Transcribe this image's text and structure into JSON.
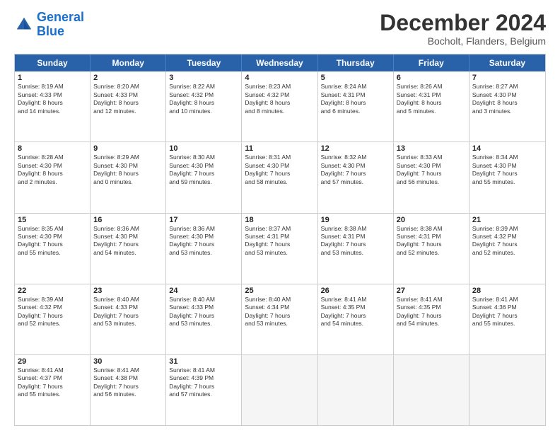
{
  "header": {
    "logo_line1": "General",
    "logo_line2": "Blue",
    "month": "December 2024",
    "location": "Bocholt, Flanders, Belgium"
  },
  "days": [
    "Sunday",
    "Monday",
    "Tuesday",
    "Wednesday",
    "Thursday",
    "Friday",
    "Saturday"
  ],
  "rows": [
    [
      {
        "day": "1",
        "lines": [
          "Sunrise: 8:19 AM",
          "Sunset: 4:33 PM",
          "Daylight: 8 hours",
          "and 14 minutes."
        ]
      },
      {
        "day": "2",
        "lines": [
          "Sunrise: 8:20 AM",
          "Sunset: 4:33 PM",
          "Daylight: 8 hours",
          "and 12 minutes."
        ]
      },
      {
        "day": "3",
        "lines": [
          "Sunrise: 8:22 AM",
          "Sunset: 4:32 PM",
          "Daylight: 8 hours",
          "and 10 minutes."
        ]
      },
      {
        "day": "4",
        "lines": [
          "Sunrise: 8:23 AM",
          "Sunset: 4:32 PM",
          "Daylight: 8 hours",
          "and 8 minutes."
        ]
      },
      {
        "day": "5",
        "lines": [
          "Sunrise: 8:24 AM",
          "Sunset: 4:31 PM",
          "Daylight: 8 hours",
          "and 6 minutes."
        ]
      },
      {
        "day": "6",
        "lines": [
          "Sunrise: 8:26 AM",
          "Sunset: 4:31 PM",
          "Daylight: 8 hours",
          "and 5 minutes."
        ]
      },
      {
        "day": "7",
        "lines": [
          "Sunrise: 8:27 AM",
          "Sunset: 4:30 PM",
          "Daylight: 8 hours",
          "and 3 minutes."
        ]
      }
    ],
    [
      {
        "day": "8",
        "lines": [
          "Sunrise: 8:28 AM",
          "Sunset: 4:30 PM",
          "Daylight: 8 hours",
          "and 2 minutes."
        ]
      },
      {
        "day": "9",
        "lines": [
          "Sunrise: 8:29 AM",
          "Sunset: 4:30 PM",
          "Daylight: 8 hours",
          "and 0 minutes."
        ]
      },
      {
        "day": "10",
        "lines": [
          "Sunrise: 8:30 AM",
          "Sunset: 4:30 PM",
          "Daylight: 7 hours",
          "and 59 minutes."
        ]
      },
      {
        "day": "11",
        "lines": [
          "Sunrise: 8:31 AM",
          "Sunset: 4:30 PM",
          "Daylight: 7 hours",
          "and 58 minutes."
        ]
      },
      {
        "day": "12",
        "lines": [
          "Sunrise: 8:32 AM",
          "Sunset: 4:30 PM",
          "Daylight: 7 hours",
          "and 57 minutes."
        ]
      },
      {
        "day": "13",
        "lines": [
          "Sunrise: 8:33 AM",
          "Sunset: 4:30 PM",
          "Daylight: 7 hours",
          "and 56 minutes."
        ]
      },
      {
        "day": "14",
        "lines": [
          "Sunrise: 8:34 AM",
          "Sunset: 4:30 PM",
          "Daylight: 7 hours",
          "and 55 minutes."
        ]
      }
    ],
    [
      {
        "day": "15",
        "lines": [
          "Sunrise: 8:35 AM",
          "Sunset: 4:30 PM",
          "Daylight: 7 hours",
          "and 55 minutes."
        ]
      },
      {
        "day": "16",
        "lines": [
          "Sunrise: 8:36 AM",
          "Sunset: 4:30 PM",
          "Daylight: 7 hours",
          "and 54 minutes."
        ]
      },
      {
        "day": "17",
        "lines": [
          "Sunrise: 8:36 AM",
          "Sunset: 4:30 PM",
          "Daylight: 7 hours",
          "and 53 minutes."
        ]
      },
      {
        "day": "18",
        "lines": [
          "Sunrise: 8:37 AM",
          "Sunset: 4:31 PM",
          "Daylight: 7 hours",
          "and 53 minutes."
        ]
      },
      {
        "day": "19",
        "lines": [
          "Sunrise: 8:38 AM",
          "Sunset: 4:31 PM",
          "Daylight: 7 hours",
          "and 53 minutes."
        ]
      },
      {
        "day": "20",
        "lines": [
          "Sunrise: 8:38 AM",
          "Sunset: 4:31 PM",
          "Daylight: 7 hours",
          "and 52 minutes."
        ]
      },
      {
        "day": "21",
        "lines": [
          "Sunrise: 8:39 AM",
          "Sunset: 4:32 PM",
          "Daylight: 7 hours",
          "and 52 minutes."
        ]
      }
    ],
    [
      {
        "day": "22",
        "lines": [
          "Sunrise: 8:39 AM",
          "Sunset: 4:32 PM",
          "Daylight: 7 hours",
          "and 52 minutes."
        ]
      },
      {
        "day": "23",
        "lines": [
          "Sunrise: 8:40 AM",
          "Sunset: 4:33 PM",
          "Daylight: 7 hours",
          "and 53 minutes."
        ]
      },
      {
        "day": "24",
        "lines": [
          "Sunrise: 8:40 AM",
          "Sunset: 4:33 PM",
          "Daylight: 7 hours",
          "and 53 minutes."
        ]
      },
      {
        "day": "25",
        "lines": [
          "Sunrise: 8:40 AM",
          "Sunset: 4:34 PM",
          "Daylight: 7 hours",
          "and 53 minutes."
        ]
      },
      {
        "day": "26",
        "lines": [
          "Sunrise: 8:41 AM",
          "Sunset: 4:35 PM",
          "Daylight: 7 hours",
          "and 54 minutes."
        ]
      },
      {
        "day": "27",
        "lines": [
          "Sunrise: 8:41 AM",
          "Sunset: 4:35 PM",
          "Daylight: 7 hours",
          "and 54 minutes."
        ]
      },
      {
        "day": "28",
        "lines": [
          "Sunrise: 8:41 AM",
          "Sunset: 4:36 PM",
          "Daylight: 7 hours",
          "and 55 minutes."
        ]
      }
    ],
    [
      {
        "day": "29",
        "lines": [
          "Sunrise: 8:41 AM",
          "Sunset: 4:37 PM",
          "Daylight: 7 hours",
          "and 55 minutes."
        ]
      },
      {
        "day": "30",
        "lines": [
          "Sunrise: 8:41 AM",
          "Sunset: 4:38 PM",
          "Daylight: 7 hours",
          "and 56 minutes."
        ]
      },
      {
        "day": "31",
        "lines": [
          "Sunrise: 8:41 AM",
          "Sunset: 4:39 PM",
          "Daylight: 7 hours",
          "and 57 minutes."
        ]
      },
      null,
      null,
      null,
      null
    ]
  ]
}
